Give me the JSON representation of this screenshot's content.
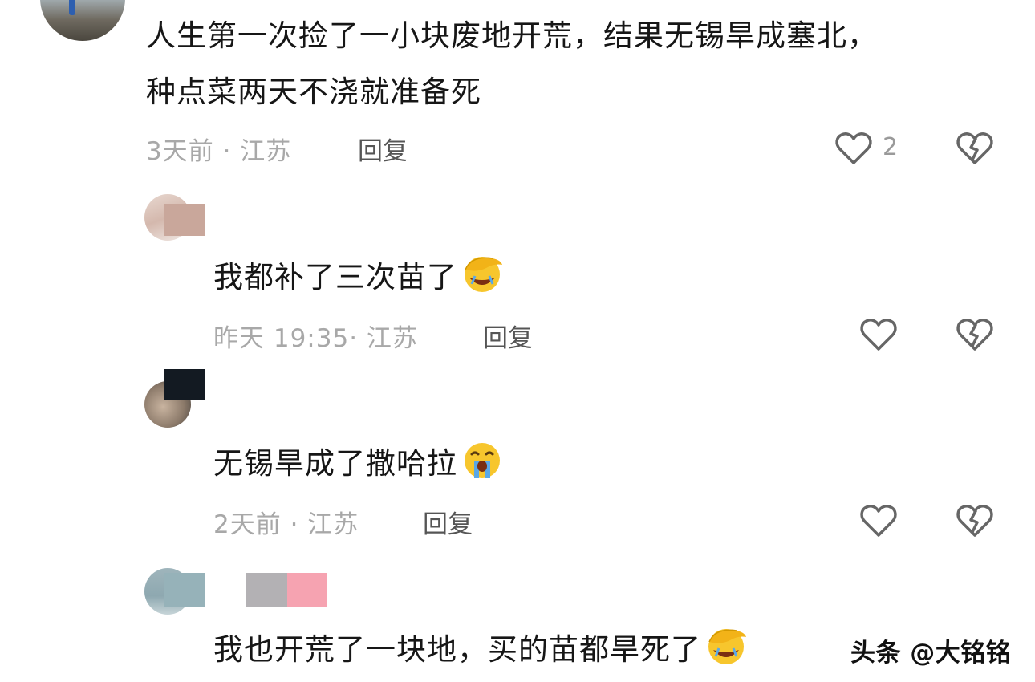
{
  "comments": [
    {
      "text_line1": "人生第一次捡了一小块废地开荒，结果无锡旱成塞北，",
      "text_line2": "种点菜两天不浇就准备死",
      "meta": "3天前 · 江苏",
      "reply_label": "回复",
      "like_count": "2"
    },
    {
      "text": "我都补了三次苗了",
      "meta": "昨天 19:35· 江苏",
      "reply_label": "回复"
    },
    {
      "text": "无锡旱成了撒哈拉",
      "meta": "2天前 · 江苏",
      "reply_label": "回复"
    },
    {
      "text": "我也开荒了一块地，买的苗都旱死了"
    }
  ],
  "watermark": "头条 @大铭铭",
  "icons": {
    "like": "heart-outline-icon",
    "dislike": "broken-heart-icon",
    "emoji_facepalm_cry": "facepalm-crying-emoji",
    "emoji_loud_cry": "loudly-crying-emoji"
  },
  "colors": {
    "text": "#161616",
    "meta": "#a8a8a8",
    "icon": "#666666"
  }
}
